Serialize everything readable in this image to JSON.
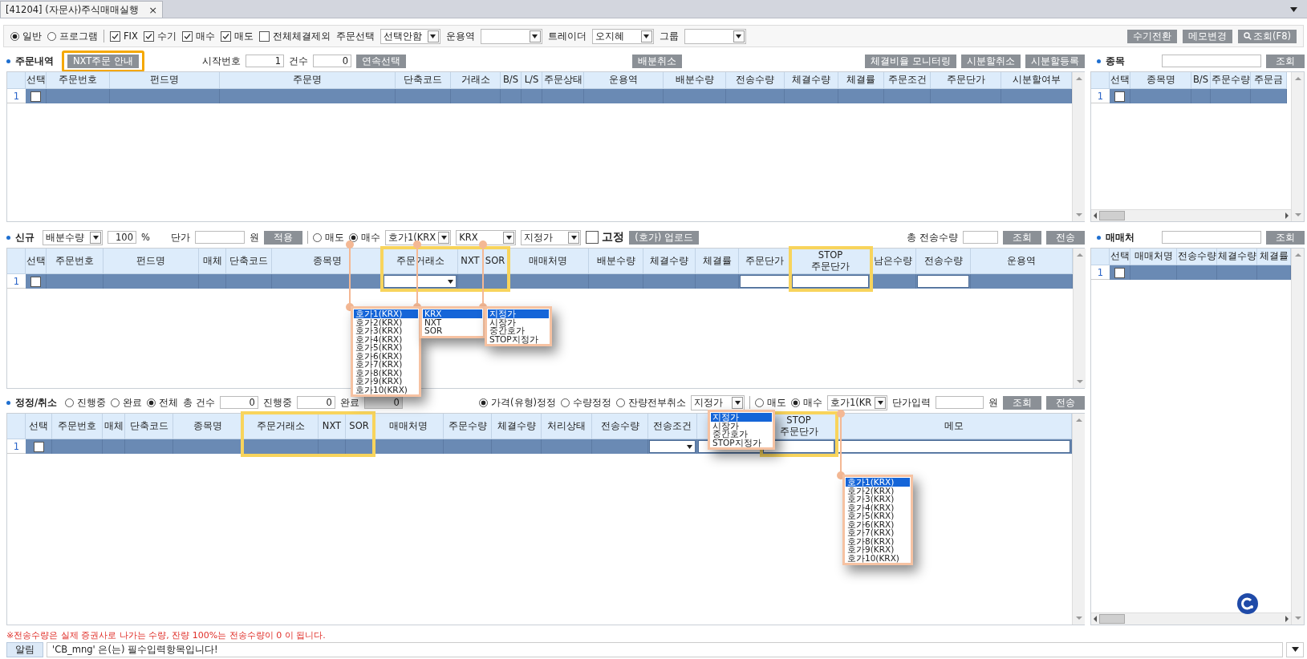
{
  "window": {
    "title": "[41204] (자문사)주식매매실행",
    "close": "×"
  },
  "toolbar": {
    "mode_options": [
      {
        "label": "일반",
        "selected": true
      },
      {
        "label": "프로그램",
        "selected": false
      }
    ],
    "filters": [
      {
        "label": "FIX",
        "checked": true
      },
      {
        "label": "수기",
        "checked": true
      },
      {
        "label": "매수",
        "checked": true
      },
      {
        "label": "매도",
        "checked": true
      },
      {
        "label": "전체체결제외",
        "checked": false
      }
    ],
    "dropdowns": [
      {
        "label": "주문선택",
        "value": "선택안함"
      },
      {
        "label": "운용역"
      },
      {
        "label": "트레이더",
        "value": "오지혜"
      },
      {
        "label": "그룹"
      }
    ],
    "buttons": [
      {
        "label": "수기전환",
        "kind": "plain"
      },
      {
        "label": "메모변경",
        "kind": "plain"
      },
      {
        "label": "조회(F8)",
        "kind": "search"
      }
    ]
  },
  "orders": {
    "title": "주문내역",
    "guide_button": {
      "label": "NXT주문 안내",
      "highlighted": true
    },
    "fields": [
      {
        "label": "시작번호",
        "value": "1"
      },
      {
        "label": "건수",
        "value": "0"
      }
    ],
    "continue_button": "연속선택",
    "cancel_button": "배분취소",
    "right_buttons": [
      "체결비율 모니터링",
      "시분할취소",
      "시분할등록"
    ],
    "columns": [
      {
        "label": "선택",
        "kind": "checkbox"
      },
      {
        "label": "주문번호"
      },
      {
        "label": "펀드명"
      },
      {
        "label": "주문명"
      },
      {
        "label": "단축코드"
      },
      {
        "label": "거래소"
      },
      {
        "label": "B/S"
      },
      {
        "label": "L/S"
      },
      {
        "label": "주문상태"
      },
      {
        "label": "운용역"
      },
      {
        "label": "배분수량"
      },
      {
        "label": "전송수량"
      },
      {
        "label": "체결수량"
      },
      {
        "label": "체결률"
      },
      {
        "label": "주문조건"
      },
      {
        "label": "주문단가"
      },
      {
        "label": "시분할여부"
      }
    ],
    "rows": [
      {
        "number": "1",
        "checked": false
      }
    ]
  },
  "new_order": {
    "title": "신규",
    "allocation": "배분수량",
    "ratio": {
      "value": "100",
      "unit": "%"
    },
    "price": {
      "label": "단가",
      "unit": "원"
    },
    "apply_button": "적용",
    "side_options": [
      {
        "label": "매도",
        "selected": false
      },
      {
        "label": "매수",
        "selected": true
      }
    ],
    "selects": [
      "호가1(KRX",
      "KRX",
      "지정가"
    ],
    "fix": {
      "label": "고정",
      "checked": false
    },
    "upload_button": "(호가) 업로드",
    "total_label": "총 전송수량",
    "buttons": [
      "조회",
      "전송"
    ],
    "columns": [
      {
        "label": "선택",
        "kind": "checkbox",
        "highlighted": false
      },
      {
        "label": "주문번호",
        "highlighted": false
      },
      {
        "label": "펀드명",
        "highlighted": false
      },
      {
        "label": "매체",
        "highlighted": false
      },
      {
        "label": "단축코드",
        "highlighted": false
      },
      {
        "label": "종목명",
        "highlighted": false
      },
      {
        "label": "주문거래소",
        "kind": "dropdown",
        "highlighted": true
      },
      {
        "label": "NXT",
        "highlighted": true
      },
      {
        "label": "SOR",
        "highlighted": true
      },
      {
        "label": "매매처명",
        "highlighted": false
      },
      {
        "label": "배분수량",
        "highlighted": false
      },
      {
        "label": "체결수량",
        "highlighted": false
      },
      {
        "label": "체결률",
        "highlighted": false
      },
      {
        "label": "주문단가",
        "kind": "input",
        "highlighted": false
      },
      {
        "label": "STOP\n주문단가",
        "kind": "input",
        "highlighted": true
      },
      {
        "label": "남은수량",
        "highlighted": false
      },
      {
        "label": "전송수량",
        "kind": "input",
        "highlighted": false
      },
      {
        "label": "운용역",
        "highlighted": false
      }
    ],
    "rows": [
      {
        "number": "1",
        "checked": false
      }
    ],
    "callouts": [
      {
        "options": [
          {
            "label": "호가1(KRX)",
            "selected": true
          },
          {
            "label": "호가2(KRX)",
            "selected": false
          },
          {
            "label": "호가3(KRX)",
            "selected": false
          },
          {
            "label": "호가4(KRX)",
            "selected": false
          },
          {
            "label": "호가5(KRX)",
            "selected": false
          },
          {
            "label": "호가6(KRX)",
            "selected": false
          },
          {
            "label": "호가7(KRX)",
            "selected": false
          },
          {
            "label": "호가8(KRX)",
            "selected": false
          },
          {
            "label": "호가9(KRX)",
            "selected": false
          },
          {
            "label": "호가10(KRX)",
            "selected": false
          }
        ]
      },
      {
        "options": [
          {
            "label": "KRX",
            "selected": true
          },
          {
            "label": "NXT",
            "selected": false
          },
          {
            "label": "SOR",
            "selected": false
          }
        ]
      },
      {
        "options": [
          {
            "label": "지정가",
            "selected": true
          },
          {
            "label": "시장가",
            "selected": false
          },
          {
            "label": "중간호가",
            "selected": false
          },
          {
            "label": "STOP지정가",
            "selected": false
          }
        ]
      }
    ]
  },
  "modify": {
    "title": "정정/취소",
    "status_options": [
      {
        "label": "진행중",
        "selected": false
      },
      {
        "label": "완료",
        "selected": false
      },
      {
        "label": "전체",
        "selected": true
      }
    ],
    "counts": [
      {
        "label": "총 건수",
        "value": "0",
        "readonly": false
      },
      {
        "label": "진행중",
        "value": "0",
        "readonly": false
      },
      {
        "label": "완료",
        "value": "0",
        "readonly": true
      }
    ],
    "modify_types": [
      {
        "label": "가격(유형)정정",
        "selected": true
      },
      {
        "label": "수량정정",
        "selected": false
      },
      {
        "label": "잔량전부취소",
        "selected": false
      }
    ],
    "type_select": "지정가",
    "side_options": [
      {
        "label": "매도",
        "selected": false
      },
      {
        "label": "매수",
        "selected": true
      }
    ],
    "price_select": "호가1(KR",
    "price_input": {
      "label": "단가입력",
      "unit": "원"
    },
    "buttons": [
      "조회",
      "전송"
    ],
    "columns": [
      {
        "label": "선택",
        "kind": "checkbox",
        "highlighted": false
      },
      {
        "label": "주문번호",
        "highlighted": false
      },
      {
        "label": "매체",
        "highlighted": false
      },
      {
        "label": "단축코드",
        "highlighted": false
      },
      {
        "label": "종목명",
        "highlighted": false
      },
      {
        "label": "주문거래소",
        "highlighted": true
      },
      {
        "label": "NXT",
        "highlighted": true
      },
      {
        "label": "SOR",
        "highlighted": true
      },
      {
        "label": "매매처명",
        "highlighted": false
      },
      {
        "label": "주문수량",
        "highlighted": false
      },
      {
        "label": "체결수량",
        "highlighted": false
      },
      {
        "label": "처리상태",
        "highlighted": false
      },
      {
        "label": "전송수량",
        "highlighted": false
      },
      {
        "label": "전송조건",
        "kind": "dropdown",
        "highlighted": false
      },
      {
        "kind": "input",
        "highlighted": false
      },
      {
        "label": "STOP\n주문단가",
        "kind": "input",
        "highlighted": true
      },
      {
        "label": "메모",
        "kind": "input",
        "highlighted": false
      }
    ],
    "rows": [
      {
        "number": "1",
        "checked": false
      }
    ],
    "callouts": [
      {
        "options": [
          {
            "label": "지정가",
            "selected": true
          },
          {
            "label": "시장가",
            "selected": false
          },
          {
            "label": "중간호가",
            "selected": false
          },
          {
            "label": "STOP지정가",
            "selected": false
          }
        ]
      },
      {
        "options": [
          {
            "label": "호가1(KRX)",
            "selected": true
          },
          {
            "label": "호가2(KRX)",
            "selected": false
          },
          {
            "label": "호가3(KRX)",
            "selected": false
          },
          {
            "label": "호가4(KRX)",
            "selected": false
          },
          {
            "label": "호가5(KRX)",
            "selected": false
          },
          {
            "label": "호가6(KRX)",
            "selected": false
          },
          {
            "label": "호가7(KRX)",
            "selected": false
          },
          {
            "label": "호가8(KRX)",
            "selected": false
          },
          {
            "label": "호가9(KRX)",
            "selected": false
          },
          {
            "label": "호가10(KRX)",
            "selected": false
          }
        ]
      }
    ]
  },
  "stock_panel": {
    "title": "종목",
    "search_button": "조회",
    "columns": [
      {
        "label": "선택",
        "kind": "checkbox"
      },
      {
        "label": "종목명"
      },
      {
        "label": "B/S"
      },
      {
        "label": "주문수량"
      },
      {
        "label": "주문금"
      }
    ],
    "rows": [
      {
        "number": "1",
        "checked": false
      }
    ]
  },
  "broker_panel": {
    "title": "매매처",
    "search_button": "조회",
    "columns": [
      {
        "label": "선택",
        "kind": "checkbox"
      },
      {
        "label": "매매처명"
      },
      {
        "label": "전송수량"
      },
      {
        "label": "체결수량"
      },
      {
        "label": "체결률"
      }
    ],
    "rows": [
      {
        "number": "1",
        "checked": false
      }
    ]
  },
  "notice": "※전송수량은 실제 증권사로 나가는 수량, 잔량 100%는 전송수량이 0 이 됩니다.",
  "alert": {
    "label": "알림",
    "message": "'CB_mng' 은(는) 필수입력항목입니다!"
  }
}
